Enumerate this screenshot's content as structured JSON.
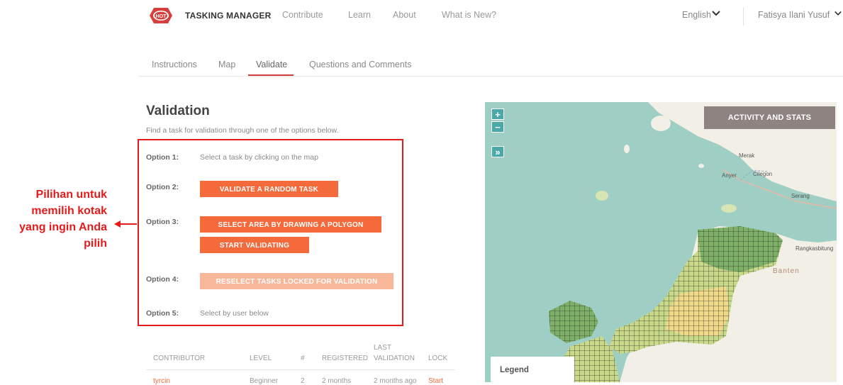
{
  "nav": {
    "brand": "TASKING MANAGER",
    "logo_text": "HOT",
    "links": [
      "Contribute",
      "Learn",
      "About",
      "What is New?"
    ],
    "language": "English",
    "user": "Fatisya Ilani Yusuf"
  },
  "tabs": [
    "Instructions",
    "Map",
    "Validate",
    "Questions and Comments"
  ],
  "active_tab": "Validate",
  "validation": {
    "title": "Validation",
    "subtitle": "Find a task for validation through one of the options below.",
    "options": [
      {
        "label": "Option 1:",
        "text": "Select a task by clicking on the map"
      },
      {
        "label": "Option 2:",
        "button": "VALIDATE A RANDOM TASK"
      },
      {
        "label": "Option 3:",
        "button": "SELECT AREA BY DRAWING A POLYGON",
        "button2": "START VALIDATING"
      },
      {
        "label": "Option 4:",
        "button": "RESELECT TASKS LOCKED FOR VALIDATION"
      },
      {
        "label": "Option 5:",
        "text": "Select by user below"
      }
    ]
  },
  "callout": {
    "lines": [
      "Pilihan untuk",
      "memilih kotak",
      "yang ingin Anda",
      "pilih"
    ],
    "color": "#e31b1b"
  },
  "table": {
    "headers": [
      "CONTRIBUTOR",
      "LEVEL",
      "#",
      "REGISTERED",
      "LAST",
      "VALIDATION",
      "LOCK"
    ],
    "rows": [
      {
        "contributor": "tyrcin",
        "level": "Beginner",
        "count": "2",
        "registered": "2 months",
        "last_validation": "2 months ago",
        "lock": "Start"
      }
    ]
  },
  "map": {
    "zoom_in": "+",
    "zoom_out": "−",
    "expand": "»",
    "activity_button": "ACTIVITY AND STATS",
    "legend": "Legend",
    "places": [
      "Merak",
      "Anyer",
      "Cilegon",
      "Serang",
      "Rangkasbitung",
      "Banten"
    ]
  },
  "colors": {
    "accent": "#f56a3b",
    "accent_disabled": "#f9b79a",
    "highlight_box": "#e31b1b",
    "water": "#9fcfc4",
    "land": "#f2efe6"
  }
}
